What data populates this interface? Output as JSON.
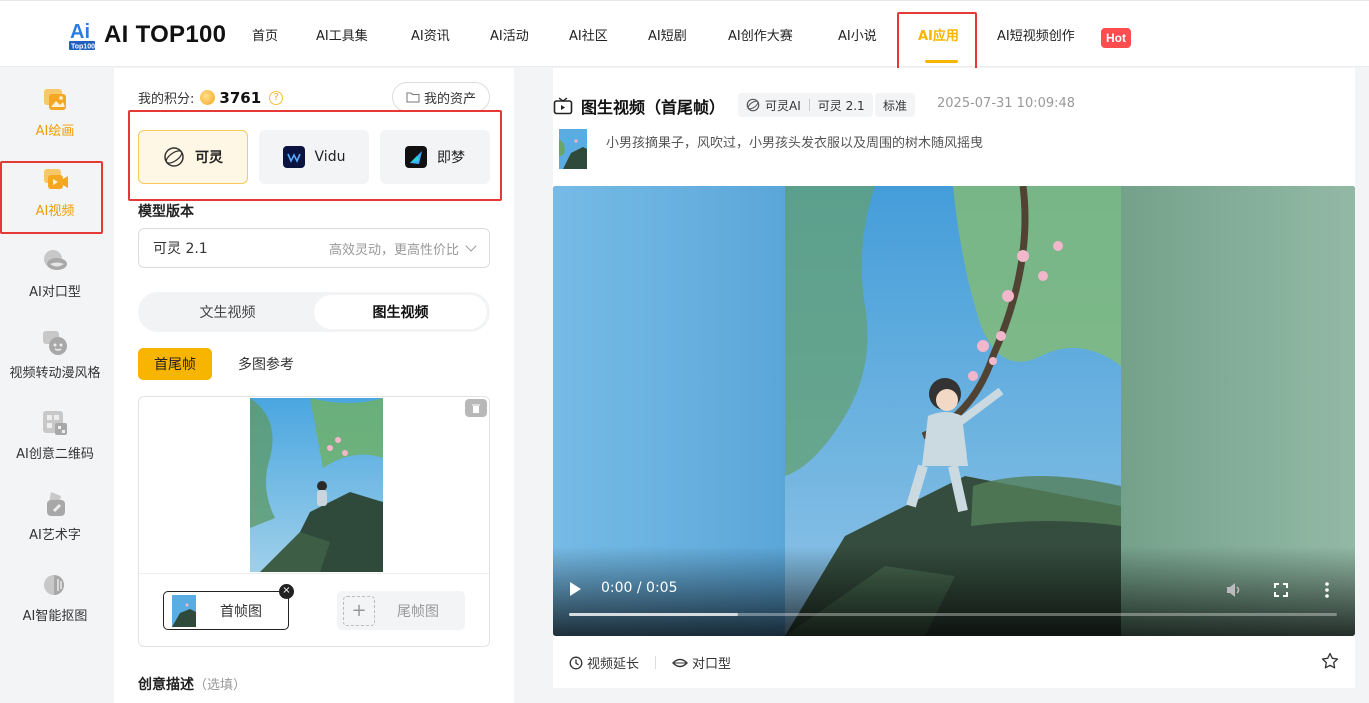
{
  "brand": {
    "name": "AI TOP100",
    "accent": "#f7b500",
    "hot_color": "#ff4d4f"
  },
  "nav": {
    "items": [
      {
        "label": "首页"
      },
      {
        "label": "AI工具集"
      },
      {
        "label": "AI资讯"
      },
      {
        "label": "AI活动"
      },
      {
        "label": "AI社区"
      },
      {
        "label": "AI短剧"
      },
      {
        "label": "AI创作大赛"
      },
      {
        "label": "AI小说"
      },
      {
        "label": "AI应用",
        "active": true
      },
      {
        "label": "AI短视频创作"
      }
    ],
    "hot_badge": "Hot"
  },
  "sidebar": {
    "items": [
      {
        "label": "AI绘画",
        "icon": "picture-icon"
      },
      {
        "label": "AI视频",
        "icon": "video-icon",
        "active": true
      },
      {
        "label": "AI对口型",
        "icon": "lips-icon"
      },
      {
        "label": "视频转动漫风格",
        "icon": "anime-icon"
      },
      {
        "label": "AI创意二维码",
        "icon": "qrcode-icon"
      },
      {
        "label": "AI艺术字",
        "icon": "art-text-icon"
      },
      {
        "label": "AI智能抠图",
        "icon": "cutout-icon"
      }
    ]
  },
  "form": {
    "points_label": "我的积分:",
    "points_value": "3761",
    "assets_label": "我的资产",
    "models": [
      {
        "label": "可灵",
        "selected": true
      },
      {
        "label": "Vidu"
      },
      {
        "label": "即梦"
      }
    ],
    "version_label": "模型版本",
    "version_value": "可灵 2.1",
    "version_hint": "高效灵动，更高性价比",
    "modes": {
      "text": "文生视频",
      "image": "图生视频",
      "active": "图生视频"
    },
    "submodes": {
      "first_last": "首尾帧",
      "multi": "多图参考",
      "active": "首尾帧"
    },
    "first_frame": "首帧图",
    "last_frame": "尾帧图",
    "desc_label": "创意描述",
    "desc_optional": "（选填）"
  },
  "preview": {
    "title": "图生视频（首尾帧）",
    "tag_model": "可灵AI",
    "tag_version": "可灵 2.1",
    "tag_quality": "标准",
    "timestamp": "2025-07-31 10:09:48",
    "prompt": "小男孩摘果子，风吹过，小男孩头发衣服以及周围的树木随风摇曳",
    "video_time": "0:00 / 0:05",
    "video_buffered_fraction": 0.22,
    "actions": {
      "extend": "视频延长",
      "lipsync": "对口型"
    }
  }
}
